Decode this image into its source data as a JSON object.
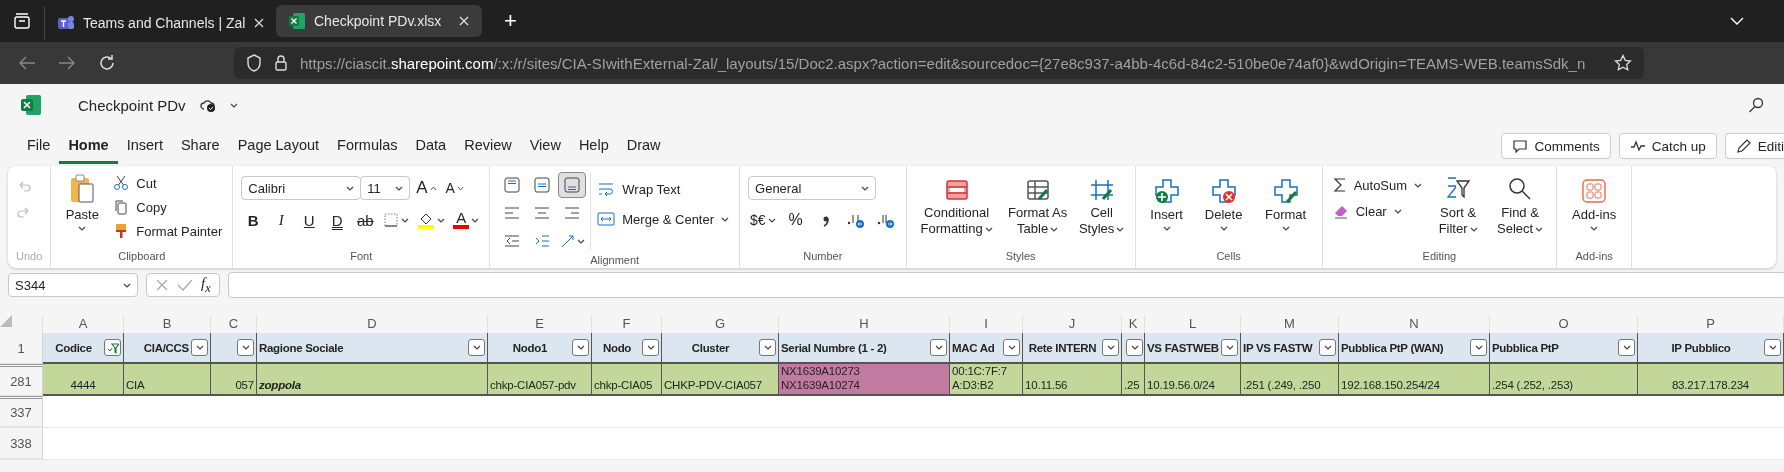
{
  "browser": {
    "tabs": [
      {
        "title": "Teams and Channels | Zal",
        "selected": false
      },
      {
        "title": "Checkpoint PDv.xlsx",
        "selected": true
      }
    ],
    "new_tab": "+",
    "url": {
      "start": "https://ciascit.",
      "domain": "sharepoint.com",
      "path": "/:x:/r/sites/CIA-SIwithExternal-Zal/_layouts/15/Doc2.aspx?action=edit&sourcedoc={27e8c937-a4bb-4c6d-84c2-510be0e74af0}&wdOrigin=TEAMS-WEB.teamsSdk_n"
    }
  },
  "app": {
    "title": "Checkpoint PDv"
  },
  "menu": [
    {
      "label": "File",
      "selected": false
    },
    {
      "label": "Home",
      "selected": true
    },
    {
      "label": "Insert",
      "selected": false
    },
    {
      "label": "Share",
      "selected": false
    },
    {
      "label": "Page Layout",
      "selected": false
    },
    {
      "label": "Formulas",
      "selected": false
    },
    {
      "label": "Data",
      "selected": false
    },
    {
      "label": "Review",
      "selected": false
    },
    {
      "label": "View",
      "selected": false
    },
    {
      "label": "Help",
      "selected": false
    },
    {
      "label": "Draw",
      "selected": false
    }
  ],
  "actions": [
    "Comments",
    "Catch up",
    "Editi"
  ],
  "ribbon": {
    "groups": [
      {
        "kind": "undo",
        "label": "Undo",
        "disabled": true
      },
      {
        "kind": "clipboard",
        "label": "Clipboard",
        "paste": "Paste",
        "items": [
          "Cut",
          "Copy",
          "Format Painter"
        ]
      },
      {
        "kind": "font",
        "label": "Font",
        "font_name": "Calibri",
        "font_size": "11",
        "size_buttons": [
          "A",
          "A"
        ],
        "style_buttons": [
          "B",
          "I",
          "U",
          "D",
          "ab"
        ],
        "color_button": "A"
      },
      {
        "kind": "alignment",
        "label": "Alignment",
        "vertical_align": [
          {
            "selected": false
          },
          {
            "selected": false
          },
          {
            "selected": true
          }
        ],
        "wrap": "Wrap Text",
        "merge": "Merge & Center"
      },
      {
        "kind": "number",
        "label": "Number",
        "format": "General",
        "currency": "$€",
        "percent": "%"
      },
      {
        "kind": "styles",
        "label": "Styles",
        "buttons": [
          "Conditional Formatting",
          "Format As Table",
          "Cell Styles"
        ]
      },
      {
        "kind": "cells",
        "label": "Cells",
        "buttons": [
          "Insert",
          "Delete",
          "Format"
        ]
      },
      {
        "kind": "editing",
        "label": "Editing",
        "items": [
          "AutoSum",
          "Clear"
        ],
        "buttons": [
          "Sort & Filter",
          "Find & Select"
        ]
      },
      {
        "kind": "addins",
        "label": "Add-ins",
        "buttons": [
          "Add-ins"
        ]
      }
    ]
  },
  "formula_bar": {
    "name_box": "S344",
    "function_label": "f$_{x}$"
  },
  "sheet": {
    "columns": [
      {
        "letter": "A",
        "header": "Codice",
        "filtered": true
      },
      {
        "letter": "B",
        "header": "CIA/CCS",
        "filtered": false
      },
      {
        "letter": "C",
        "filtered": false
      },
      {
        "letter": "D",
        "header": "Ragione Sociale",
        "filtered": false
      },
      {
        "letter": "E",
        "header": "Nodo1",
        "filtered": false
      },
      {
        "letter": "F",
        "header": "Nodo",
        "filtered": false
      },
      {
        "letter": "G",
        "header": "Cluster",
        "filtered": false
      },
      {
        "letter": "H",
        "header": "Serial Numbre (1 - 2)",
        "filtered": false
      },
      {
        "letter": "I",
        "header": "MAC Ad",
        "filtered": false
      },
      {
        "letter": "J",
        "header": "Rete INTERN",
        "filtered": false
      },
      {
        "letter": "K",
        "filtered": false
      },
      {
        "letter": "L",
        "header": "VS FASTWEB",
        "filtered": false
      },
      {
        "letter": "M",
        "header": "IP VS FASTW",
        "filtered": false
      },
      {
        "letter": "N",
        "header": "Pubblica PtP (WAN)",
        "filtered": false
      },
      {
        "letter": "O",
        "header": "Pubblica PtP",
        "filtered": false
      },
      {
        "letter": "P",
        "header": "IP Pubblico",
        "filtered": false
      }
    ],
    "header_row": "1",
    "rows": [
      {
        "number": "281",
        "cells": [
          {
            "lines": [
              "4444"
            ],
            "color": "#c4d79b"
          },
          {
            "lines": [
              "CIA"
            ],
            "color": "#c4d79b"
          },
          {
            "lines": [
              "057"
            ],
            "color": "#c4d79b"
          },
          {
            "lines": [
              "zoppola"
            ],
            "color": "#c4d79b"
          },
          {
            "lines": [
              "chkp-CIA057-pdv"
            ],
            "color": "#c4d79b"
          },
          {
            "lines": [
              "chkp-CIA05"
            ],
            "color": "#c4d79b"
          },
          {
            "lines": [
              "CHKP-PDV-CIA057"
            ],
            "color": "#c4d79b"
          },
          {
            "lines": [
              "NX1639A10273",
              "NX1639A10274"
            ],
            "color": "#c27ba0"
          },
          {
            "lines": [
              "00:1C:7F:7",
              "A:D3:B2"
            ],
            "color": "#c4d79b"
          },
          {
            "lines": [
              "10.11.56"
            ],
            "color": "#c4d79b"
          },
          {
            "lines": [
              ".25"
            ],
            "color": "#c4d79b"
          },
          {
            "lines": [
              "10.19.56.0/24"
            ],
            "color": "#c4d79b"
          },
          {
            "lines": [
              ".251 (.249, .250"
            ],
            "color": "#c4d79b"
          },
          {
            "lines": [
              "192.168.150.254/24"
            ],
            "color": "#c4d79b"
          },
          {
            "lines": [
              ".254 (.252, .253)"
            ],
            "color": "#c4d79b"
          },
          {
            "lines": [
              "83.217.178.234"
            ],
            "color": "#c4d79b"
          }
        ]
      }
    ],
    "empty_rows": [
      "337",
      "338"
    ]
  }
}
